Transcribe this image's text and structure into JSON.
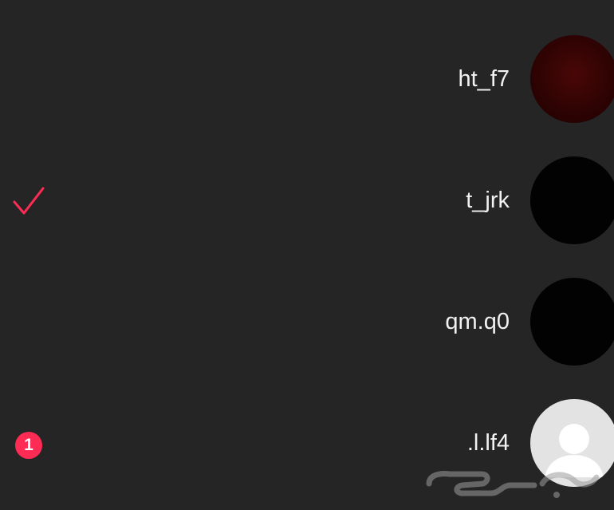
{
  "accounts": [
    {
      "username": "ht_f7",
      "avatar": "dark-red-photo",
      "selected": false,
      "unread": null
    },
    {
      "username": "t_jrk",
      "avatar": "black-photo",
      "selected": true,
      "unread": null
    },
    {
      "username": "qm.q0",
      "avatar": "black-photo",
      "selected": false,
      "unread": null
    },
    {
      "username": ".l.lf4",
      "avatar": "default-person-icon",
      "selected": false,
      "unread": "1"
    }
  ],
  "colors": {
    "background": "#252525",
    "accent": "#fe2c55",
    "text": "#f2f2f2"
  },
  "watermark": {
    "text": "حراج"
  }
}
